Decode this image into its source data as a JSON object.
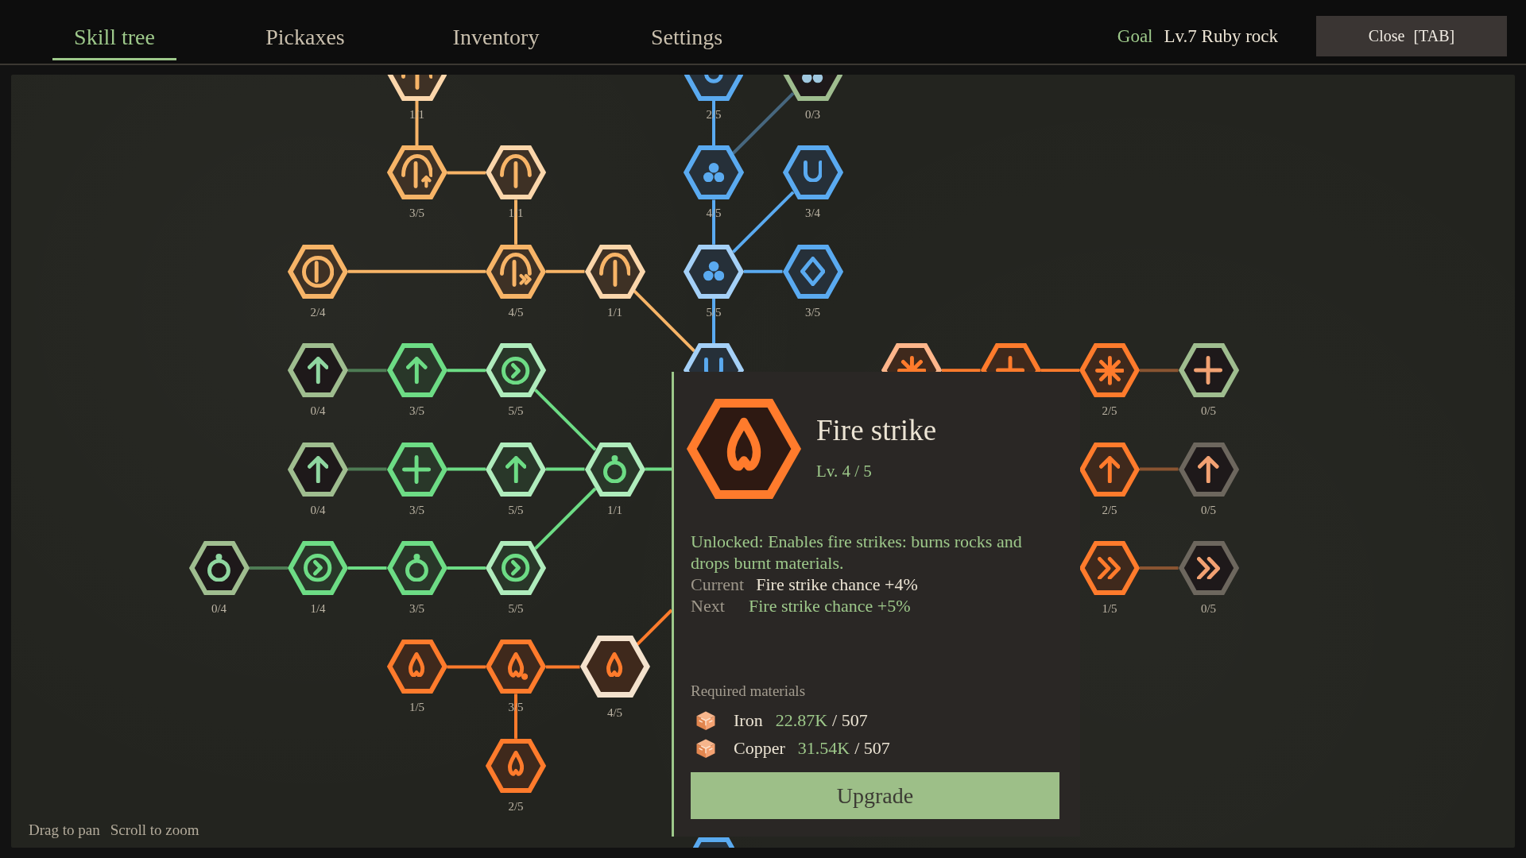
{
  "tabs": [
    {
      "label": "Skill tree",
      "selected": true
    },
    {
      "label": "Pickaxes",
      "selected": false
    },
    {
      "label": "Inventory",
      "selected": false
    },
    {
      "label": "Settings",
      "selected": false
    }
  ],
  "goal": {
    "label": "Goal",
    "value": "Lv.7 Ruby rock"
  },
  "close_button": "Close [TAB]",
  "tree": {
    "nodes": [
      {
        "kind": "pick",
        "color": "#f7b467",
        "learned": true,
        "maxed": true,
        "locked": false,
        "rank": "1/1",
        "selected": false
      },
      {
        "kind": "u",
        "color": "#5aaaf0",
        "learned": true,
        "maxed": false,
        "locked": false,
        "rank": "2/5",
        "selected": false
      },
      {
        "kind": "dots",
        "color": "#a0c8e0",
        "learned": false,
        "maxed": false,
        "locked": false,
        "rank": "0/3",
        "selected": false
      },
      {
        "kind": "pick-up",
        "color": "#f7b467",
        "learned": true,
        "maxed": false,
        "locked": false,
        "rank": "3/5",
        "selected": false
      },
      {
        "kind": "pick",
        "color": "#f7b467",
        "learned": true,
        "maxed": true,
        "locked": false,
        "rank": "1/1",
        "selected": false
      },
      {
        "kind": "dots",
        "color": "#5aaaf0",
        "learned": true,
        "maxed": false,
        "locked": false,
        "rank": "4/5",
        "selected": false
      },
      {
        "kind": "u",
        "color": "#5aaaf0",
        "learned": true,
        "maxed": false,
        "locked": false,
        "rank": "3/4",
        "selected": false
      },
      {
        "kind": "circle-line",
        "color": "#f7b467",
        "learned": true,
        "maxed": false,
        "locked": false,
        "rank": "2/4",
        "selected": false
      },
      {
        "kind": "pick-fast",
        "color": "#f7b467",
        "learned": true,
        "maxed": false,
        "locked": false,
        "rank": "4/5",
        "selected": false
      },
      {
        "kind": "pick",
        "color": "#f7b467",
        "learned": true,
        "maxed": true,
        "locked": false,
        "rank": "1/1",
        "selected": false
      },
      {
        "kind": "dots",
        "color": "#5aaaf0",
        "learned": true,
        "maxed": true,
        "locked": false,
        "rank": "5/5",
        "selected": false
      },
      {
        "kind": "diamond",
        "color": "#5aaaf0",
        "learned": true,
        "maxed": false,
        "locked": false,
        "rank": "3/5",
        "selected": false
      },
      {
        "kind": "arrow-up",
        "color": "#8fd6a0",
        "learned": false,
        "maxed": false,
        "locked": false,
        "rank": "0/4",
        "selected": false
      },
      {
        "kind": "arrow-up",
        "color": "#6ddc85",
        "learned": true,
        "maxed": false,
        "locked": false,
        "rank": "3/5",
        "selected": false
      },
      {
        "kind": "chevron-circle",
        "color": "#6ddc85",
        "learned": true,
        "maxed": true,
        "locked": false,
        "rank": "5/5",
        "selected": false
      },
      {
        "kind": "u",
        "color": "#5aaaf0",
        "learned": true,
        "maxed": true,
        "locked": false,
        "selected": false
      },
      {
        "kind": "asterisk",
        "color": "#ff7b2c",
        "learned": true,
        "maxed": true,
        "locked": false,
        "selected": false
      },
      {
        "kind": "plus",
        "color": "#ff7b2c",
        "learned": true,
        "maxed": false,
        "locked": false,
        "selected": false
      },
      {
        "kind": "asterisk",
        "color": "#ff7b2c",
        "learned": true,
        "maxed": false,
        "locked": false,
        "rank": "2/5",
        "selected": false
      },
      {
        "kind": "plus",
        "color": "#f2a172",
        "learned": false,
        "maxed": false,
        "locked": false,
        "rank": "0/5",
        "selected": false
      },
      {
        "kind": "arrow-up",
        "color": "#8fd6a0",
        "learned": false,
        "maxed": false,
        "locked": false,
        "rank": "0/4",
        "selected": false
      },
      {
        "kind": "plus",
        "color": "#6ddc85",
        "learned": true,
        "maxed": false,
        "locked": false,
        "rank": "3/5",
        "selected": false
      },
      {
        "kind": "arrow-up",
        "color": "#6ddc85",
        "learned": true,
        "maxed": true,
        "locked": false,
        "rank": "5/5",
        "selected": false
      },
      {
        "kind": "ring",
        "color": "#6ddc85",
        "learned": true,
        "maxed": true,
        "locked": false,
        "rank": "1/1",
        "selected": false
      },
      {
        "kind": "arrow-up",
        "color": "#ff7b2c",
        "learned": true,
        "maxed": false,
        "locked": false,
        "rank": "2/5",
        "selected": false
      },
      {
        "kind": "arrow-up",
        "color": "#f2a172",
        "learned": false,
        "maxed": false,
        "locked": true,
        "rank": "0/5",
        "selected": false
      },
      {
        "kind": "ring",
        "color": "#8fd6a0",
        "learned": false,
        "maxed": false,
        "locked": false,
        "rank": "0/4",
        "selected": false
      },
      {
        "kind": "chevron-circle",
        "color": "#6ddc85",
        "learned": true,
        "maxed": false,
        "locked": false,
        "rank": "1/4",
        "selected": false
      },
      {
        "kind": "ring",
        "color": "#6ddc85",
        "learned": true,
        "maxed": false,
        "locked": false,
        "rank": "3/5",
        "selected": false
      },
      {
        "kind": "chevron-circle",
        "color": "#6ddc85",
        "learned": true,
        "maxed": true,
        "locked": false,
        "rank": "5/5",
        "selected": false
      },
      {
        "kind": "double-chevron",
        "color": "#ff7b2c",
        "learned": true,
        "maxed": false,
        "locked": false,
        "rank": "1/5",
        "selected": false
      },
      {
        "kind": "double-chevron",
        "color": "#f2a172",
        "learned": false,
        "maxed": false,
        "locked": true,
        "rank": "0/5",
        "selected": false
      },
      {
        "kind": "flame",
        "color": "#ff7b2c",
        "learned": true,
        "maxed": false,
        "locked": false,
        "rank": "1/5",
        "selected": false
      },
      {
        "kind": "flame-dot",
        "color": "#ff7b2c",
        "learned": true,
        "maxed": false,
        "locked": false,
        "rank": "3/5",
        "selected": false
      },
      {
        "kind": "flame",
        "color": "#ff7b2c",
        "learned": true,
        "maxed": false,
        "locked": false,
        "rank": "4/5",
        "selected": true
      },
      {
        "kind": "flame",
        "color": "#ff7b2c",
        "learned": true,
        "maxed": false,
        "locked": false,
        "rank": "2/5",
        "selected": false
      },
      {
        "color": "#5aaaf0",
        "learned": true,
        "maxed": false,
        "locked": false,
        "selected": false
      }
    ]
  },
  "details": {
    "kind": "flame",
    "color": "#ff7b2c",
    "title": "Fire strike",
    "rank": "Lv. 4 / 5",
    "description": "Unlocked: Enables fire strikes: burns rocks and drops burnt materials.",
    "stats": [
      {
        "kind": "current",
        "label": "Current",
        "value": "Fire strike chance +4%"
      },
      {
        "kind": "next",
        "label": "Next",
        "value": "Fire strike chance +5%"
      }
    ],
    "materials_title": "Required materials",
    "materials": [
      {
        "name": "Iron",
        "owned": "22.87K",
        "cost": "/ 507"
      },
      {
        "name": "Copper",
        "owned": "31.54K",
        "cost": "/ 507"
      }
    ],
    "button": "Upgrade"
  },
  "hints": [
    "Drag to pan",
    "Scroll to zoom"
  ]
}
